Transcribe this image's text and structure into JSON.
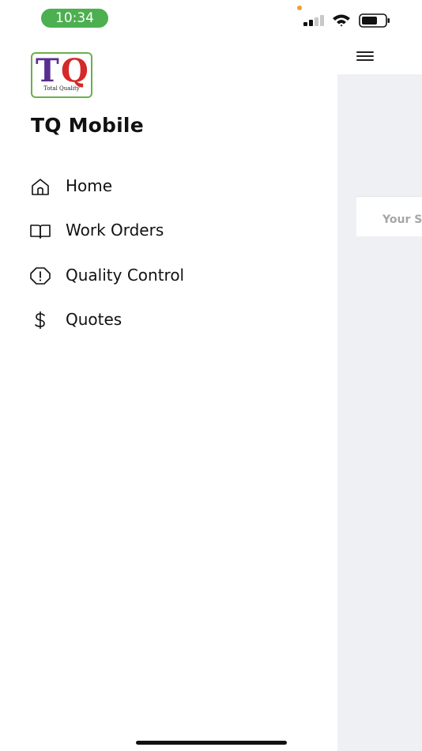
{
  "status_bar": {
    "time": "10:34",
    "time_pill_color": "#4caf50",
    "icons": [
      "signal-icon",
      "wifi-icon",
      "battery-icon"
    ]
  },
  "drawer": {
    "logo": {
      "letters_t": "T",
      "letters_q": "Q",
      "caption": "Total Quality",
      "colors": {
        "t": "#5a2e91",
        "q": "#d62828",
        "border": "#6ab04c"
      }
    },
    "app_title": "TQ Mobile",
    "menu": [
      {
        "label": "Home",
        "icon": "home-icon"
      },
      {
        "label": "Work Orders",
        "icon": "book-icon"
      },
      {
        "label": "Quality Control",
        "icon": "alert-octagon-icon"
      },
      {
        "label": "Quotes",
        "icon": "dollar-icon"
      }
    ]
  },
  "background_screen": {
    "card_text": "Your S",
    "menu_button_icon": "hamburger-icon"
  }
}
